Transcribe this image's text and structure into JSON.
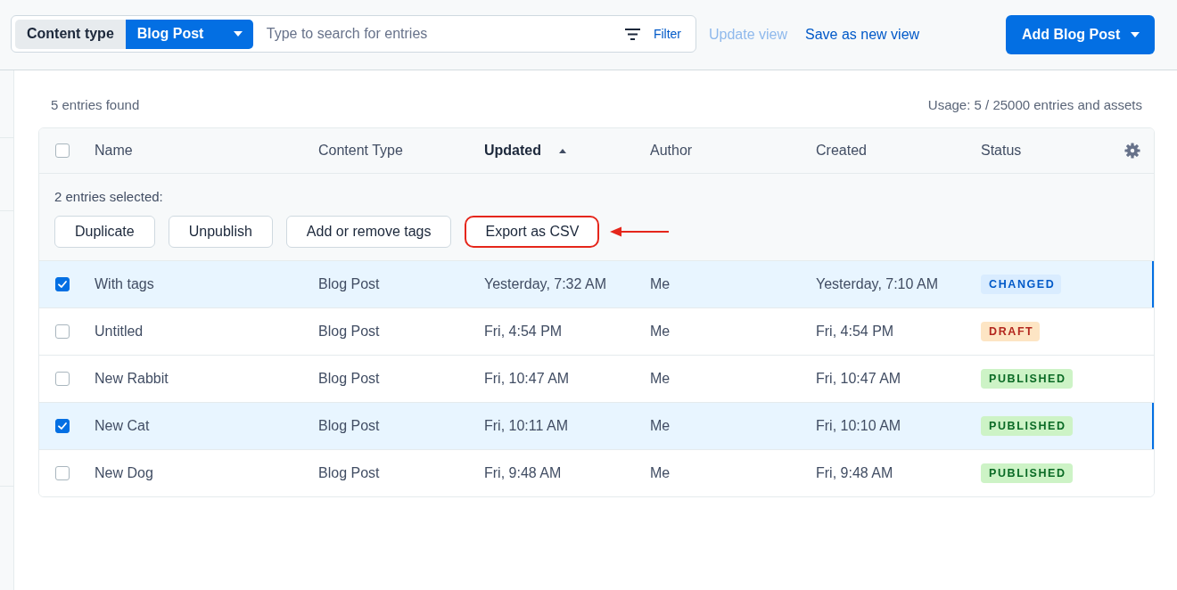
{
  "toolbar": {
    "content_type_label": "Content type",
    "content_type_value": "Blog Post",
    "search": {
      "placeholder": "Type to search for entries"
    },
    "filter_button": "Filter",
    "view_actions": [
      {
        "label": "Update view",
        "disabled": true
      },
      {
        "label": "Save as new view",
        "disabled": false
      }
    ],
    "primary_button": "Add Blog Post"
  },
  "summary": {
    "count": "5 entries found",
    "usage": "Usage: 5 / 25000 entries and assets"
  },
  "table": {
    "select_all": {
      "checked": false
    },
    "columns": [
      {
        "label": "Name",
        "sorted": false
      },
      {
        "label": "Content Type",
        "sorted": false
      },
      {
        "label": "Updated",
        "sorted": true
      },
      {
        "label": "Author",
        "sorted": false
      },
      {
        "label": "Created",
        "sorted": false
      },
      {
        "label": "Status",
        "sorted": false
      }
    ],
    "bulk_actions": {
      "label": "2 entries selected:",
      "buttons": [
        {
          "label": "Duplicate",
          "highlighted": false
        },
        {
          "label": "Unpublish",
          "highlighted": false
        },
        {
          "label": "Add or remove tags",
          "highlighted": false
        },
        {
          "label": "Export as CSV",
          "highlighted": true
        }
      ]
    },
    "rows": [
      {
        "selected": true,
        "name": "With tags",
        "content_type": "Blog Post",
        "updated": "Yesterday, 7:32 AM",
        "author": "Me",
        "created": "Yesterday, 7:10 AM",
        "status": {
          "label": "CHANGED",
          "kind": "changed"
        }
      },
      {
        "selected": false,
        "name": "Untitled",
        "content_type": "Blog Post",
        "updated": "Fri, 4:54 PM",
        "author": "Me",
        "created": "Fri, 4:54 PM",
        "status": {
          "label": "DRAFT",
          "kind": "draft"
        }
      },
      {
        "selected": false,
        "name": "New Rabbit",
        "content_type": "Blog Post",
        "updated": "Fri, 10:47 AM",
        "author": "Me",
        "created": "Fri, 10:47 AM",
        "status": {
          "label": "PUBLISHED",
          "kind": "published"
        }
      },
      {
        "selected": true,
        "name": "New Cat",
        "content_type": "Blog Post",
        "updated": "Fri, 10:11 AM",
        "author": "Me",
        "created": "Fri, 10:10 AM",
        "status": {
          "label": "PUBLISHED",
          "kind": "published"
        }
      },
      {
        "selected": false,
        "name": "New Dog",
        "content_type": "Blog Post",
        "updated": "Fri, 9:48 AM",
        "author": "Me",
        "created": "Fri, 9:48 AM",
        "status": {
          "label": "PUBLISHED",
          "kind": "published"
        }
      }
    ]
  }
}
